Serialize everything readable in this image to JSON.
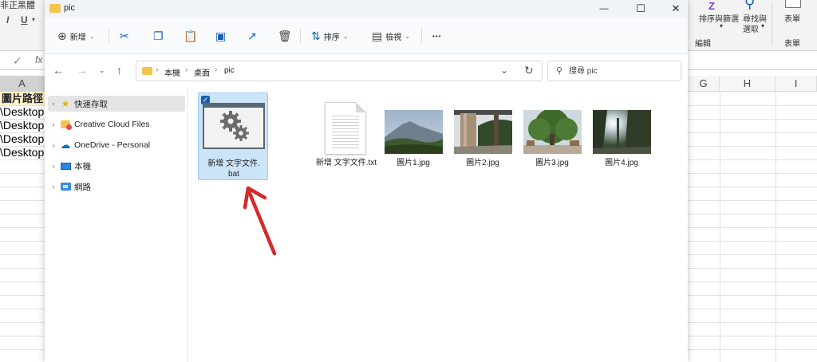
{
  "excel": {
    "ribbon_left_label": "非正黑體",
    "sort_filter_label": "排序與篩選",
    "find_select_label": "尋找與\n選取",
    "find_select_line1": "尋找與",
    "find_select_line2": "選取",
    "form_label": "表單",
    "edit_group_label": "編輯",
    "form_group_label": "表單",
    "bold_italic_italic": "I",
    "underline": "U",
    "fx": "fx",
    "check_mark": "✓",
    "sort_icon_letter": "Z",
    "columns": [
      "A",
      "G",
      "H",
      "I"
    ],
    "cells": {
      "a1": "圖片路徑",
      "rows": [
        "\\Desktop",
        "\\Desktop",
        "\\Desktop",
        "\\Desktop"
      ]
    }
  },
  "window": {
    "title": "pic",
    "minimize": "—",
    "maximize": "☐",
    "close": "✕"
  },
  "toolbar": {
    "new_label": "新增",
    "sort_label": "排序",
    "view_label": "檢視",
    "more_label": "•••"
  },
  "address": {
    "crumbs": [
      "本機",
      "桌面",
      "pic"
    ],
    "search_placeholder": "搜尋 pic"
  },
  "nav": {
    "items": [
      {
        "label": "快速存取",
        "icon": "star-icon"
      },
      {
        "label": "Creative Cloud Files",
        "icon": "creative-cloud-icon"
      },
      {
        "label": "OneDrive - Personal",
        "icon": "onedrive-icon"
      },
      {
        "label": "本機",
        "icon": "computer-icon"
      },
      {
        "label": "網路",
        "icon": "network-icon"
      }
    ]
  },
  "files": [
    {
      "name_line1": "新增 文字文件.",
      "name_line2": "bat",
      "type": "bat",
      "selected": true
    },
    {
      "name": "新增 文字文件.txt",
      "type": "txt"
    },
    {
      "name": "圖片1.jpg",
      "type": "jpg"
    },
    {
      "name": "圖片2.jpg",
      "type": "jpg"
    },
    {
      "name": "圖片3.jpg",
      "type": "jpg"
    },
    {
      "name": "圖片4.jpg",
      "type": "jpg"
    }
  ],
  "colors": {
    "selection": "#cce4f7",
    "folder": "#f3c54d",
    "accent": "#1a5fb4",
    "arrow": "#d42a2a"
  }
}
